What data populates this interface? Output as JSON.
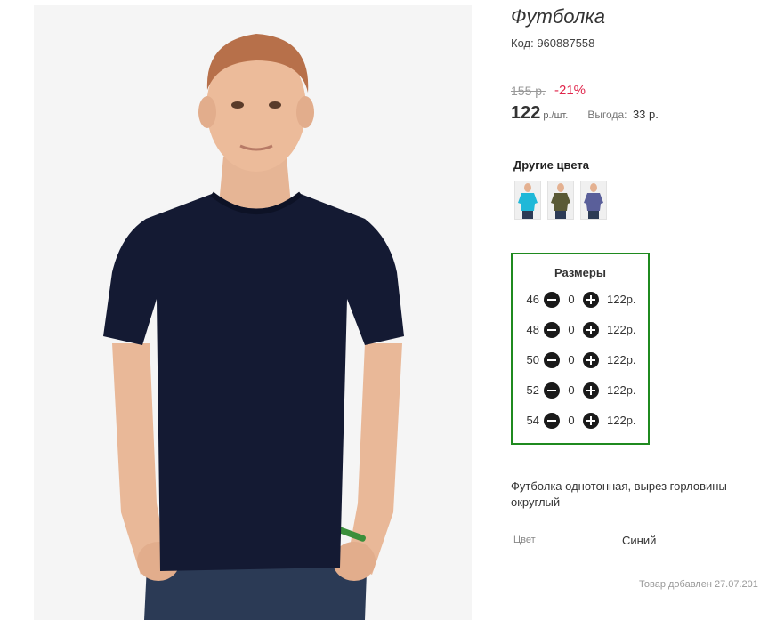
{
  "product": {
    "title": "Футболка",
    "code_text": "Код: 960887558",
    "old_price": "155 р.",
    "discount": "-21%",
    "price": "122",
    "price_unit": "р./шт.",
    "benefit_label": "Выгода:",
    "benefit_value": "33 р.",
    "image_icon": "man-in-navy-tshirt-photo"
  },
  "other_colors": {
    "heading": "Другие цвета",
    "swatches": [
      {
        "icon": "tshirt-thumbnail",
        "color": "#1fb8d8"
      },
      {
        "icon": "tshirt-thumbnail",
        "color": "#5a5a36"
      },
      {
        "icon": "tshirt-thumbnail",
        "color": "#5a5f9a"
      }
    ]
  },
  "sizes": {
    "heading": "Размеры",
    "rows": [
      {
        "size": "46",
        "qty": "0",
        "price": "122р."
      },
      {
        "size": "48",
        "qty": "0",
        "price": "122р."
      },
      {
        "size": "50",
        "qty": "0",
        "price": "122р."
      },
      {
        "size": "52",
        "qty": "0",
        "price": "122р."
      },
      {
        "size": "54",
        "qty": "0",
        "price": "122р."
      }
    ],
    "border_color": "#1f8a1f"
  },
  "description": "Футболка однотонная, вырез горловины округлый",
  "attributes": {
    "color_label": "Цвет",
    "color_value": "Синий"
  },
  "added_text": "Товар добавлен 27.07.201",
  "colors": {
    "discount": "#e0264b",
    "shirt": "#141a33"
  }
}
